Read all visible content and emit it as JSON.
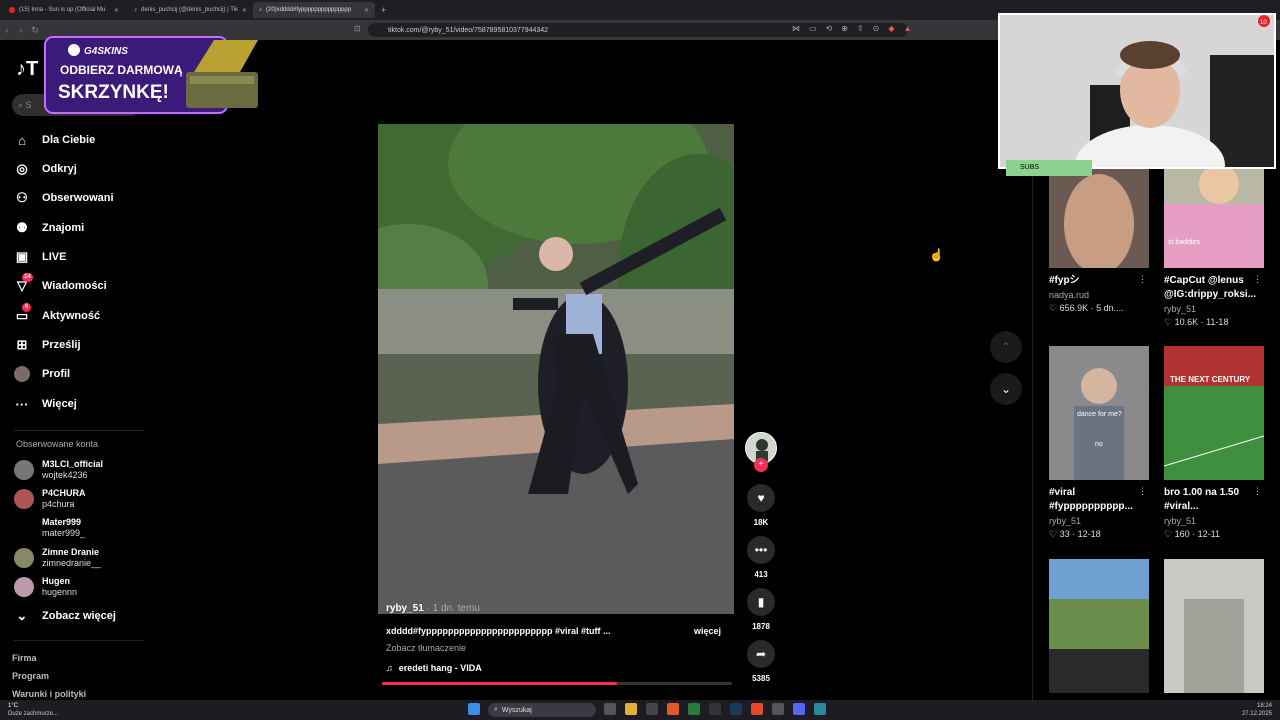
{
  "browser": {
    "tabs": [
      {
        "label": "(15) Inna - Sun is up (Official Mu"
      },
      {
        "label": "denis_puchcij (@denis_puchcij) | Tik"
      },
      {
        "label": "(20)xdddd#fyppppppppppppppp"
      }
    ],
    "url": "tiktok.com/@ryby_51/video/7587895810377944342"
  },
  "promo": {
    "brand": "G4SKINS",
    "line1": "ODBIERZ DARMOWĄ",
    "line2": "SKRZYNKĘ!"
  },
  "sidebar": {
    "search_placeholder": "S",
    "nav": [
      {
        "label": "Dla Ciebie",
        "icon": "home-icon"
      },
      {
        "label": "Odkryj",
        "icon": "compass-icon"
      },
      {
        "label": "Obserwowani",
        "icon": "following-icon"
      },
      {
        "label": "Znajomi",
        "icon": "friends-icon"
      },
      {
        "label": "LIVE",
        "icon": "live-icon"
      },
      {
        "label": "Wiadomości",
        "icon": "messages-icon",
        "badge": "14"
      },
      {
        "label": "Aktywność",
        "icon": "activity-icon",
        "badge": "6"
      },
      {
        "label": "Prześlij",
        "icon": "upload-icon"
      },
      {
        "label": "Profil",
        "icon": "profile-icon"
      },
      {
        "label": "Więcej",
        "icon": "more-icon"
      }
    ],
    "followed_title": "Obserwowane konta",
    "accounts": [
      {
        "name": "M3LCI_official",
        "handle": "wojtek4236"
      },
      {
        "name": "P4CHURA",
        "handle": "p4chura"
      },
      {
        "name": "Mater999",
        "handle": "mater999_"
      },
      {
        "name": "Zimne Dranie",
        "handle": "zimnedranie__"
      },
      {
        "name": "Hugen",
        "handle": "hugennn"
      }
    ],
    "see_more": "Zobacz więcej",
    "footer": [
      "Firma",
      "Program",
      "Warunki i polityki"
    ]
  },
  "video": {
    "author": "ryby_51",
    "time": "· 1 dn. temu",
    "caption": "xdddd#fyppppppppppppppppppppppp #viral #tuff ...",
    "more": "więcej",
    "translate": "Zobacz tłumaczenie",
    "music": "eredeti hang - VIDA",
    "progress": 0.67
  },
  "actions": {
    "likes": "18K",
    "comments": "413",
    "saves": "1878",
    "shares": "5385"
  },
  "webcam": {
    "label": "SUBS",
    "badge": "10"
  },
  "cards": [
    {
      "title": "#fypシ",
      "user": "nadya.rud",
      "stats": "656.9K · 5 dn...."
    },
    {
      "title": "#CapCut @lenus @IG:drippy_roksi...",
      "user": "ryby_51",
      "stats": "10.6K · 11-18",
      "overlay": "st baddies"
    },
    {
      "title": "#viral #fypppppppppp...",
      "user": "ryby_51",
      "stats": "33 · 12-18",
      "overlay": "dance for me?",
      "overlay2": "no"
    },
    {
      "title": "bro 1.00 na 1.50 #viral...",
      "user": "ryby_51",
      "stats": "160 · 12-11",
      "overlay": "THE NEXT CENTURY"
    },
    {
      "title": "",
      "user": "",
      "stats": ""
    },
    {
      "title": "",
      "user": "",
      "stats": ""
    }
  ],
  "taskbar": {
    "weather_temp": "1°C",
    "weather_desc": "Duże zachmurze...",
    "search": "Wyszukaj",
    "time": "18:24",
    "date": "27.12.2025"
  }
}
